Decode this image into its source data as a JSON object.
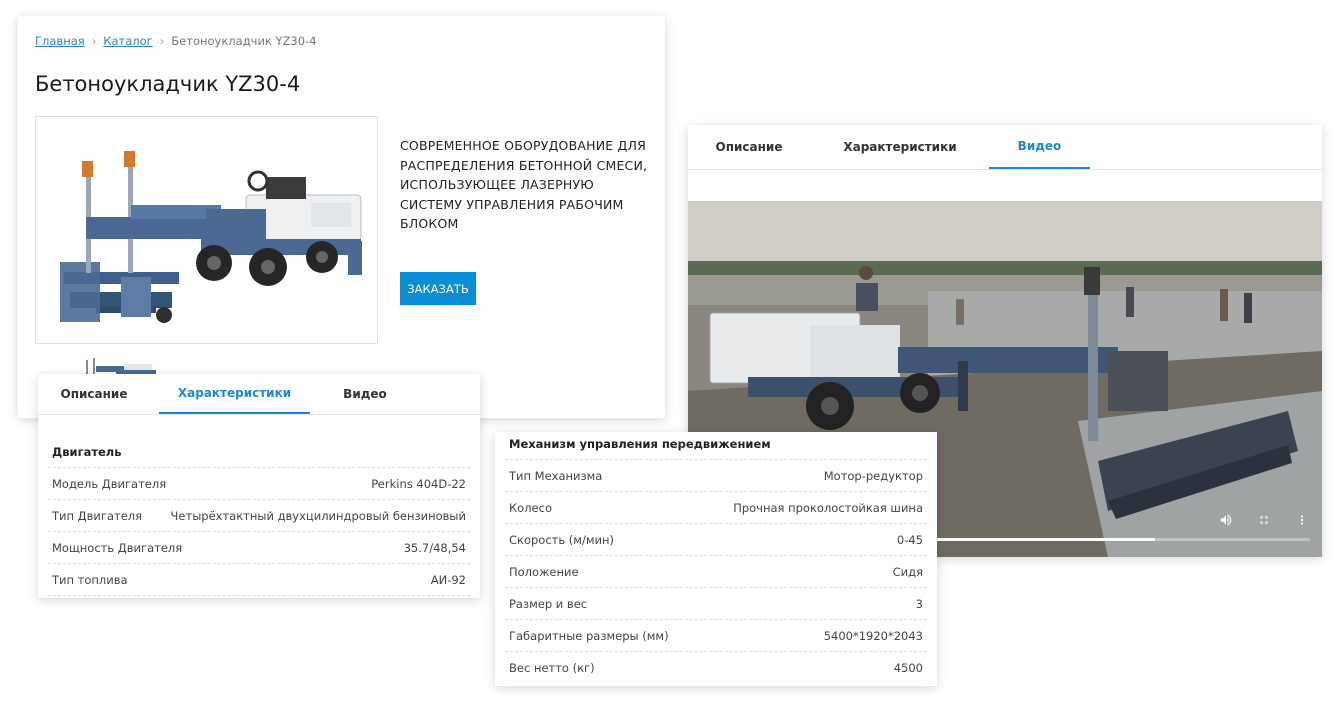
{
  "breadcrumb": {
    "home": "Главная",
    "catalog": "Каталог",
    "current": "Бетоноукладчик YZ30-4",
    "sep": "›"
  },
  "product": {
    "title": "Бетоноукладчик YZ30-4",
    "description": "Современное оборудование для распределения бетонной смеси, использующее лазерную систему управления рабочим блоком",
    "order_button": "Заказать"
  },
  "tabs": {
    "description": "Описание",
    "specs": "Характеристики",
    "video": "Видео"
  },
  "engine": {
    "heading": "Двигатель",
    "rows": [
      {
        "label": "Модель Двигателя",
        "value": "Perkins 404D-22"
      },
      {
        "label": "Тип Двигателя",
        "value": "Четырёхтактный двухцилиндровый бензиновый"
      },
      {
        "label": "Мощность Двигателя",
        "value": "35.7/48,54"
      },
      {
        "label": "Тип топлива",
        "value": "АИ-92"
      }
    ]
  },
  "drive": {
    "heading": "Механизм управления передвижением",
    "rows": [
      {
        "label": "Тип Механизма",
        "value": "Мотор-редуктор"
      },
      {
        "label": "Колесо",
        "value": "Прочная проколостойкая шина"
      },
      {
        "label": "Скорость (м/мин)",
        "value": "0-45"
      },
      {
        "label": "Положение",
        "value": "Сидя"
      },
      {
        "label": "Размер и вес",
        "value": "3"
      },
      {
        "label": "Габаритные размеры (мм)",
        "value": "5400*1920*2043"
      },
      {
        "label": "Вес нетто (кг)",
        "value": "4500"
      }
    ]
  },
  "video": {
    "progress": 0.75
  },
  "colors": {
    "accent": "#1e88d0",
    "button": "#0b8ed6",
    "machine": "#4a6a94"
  },
  "icons": {
    "volume": "volume-icon",
    "fullscreen": "fullscreen-icon",
    "more": "more-vert-icon"
  }
}
